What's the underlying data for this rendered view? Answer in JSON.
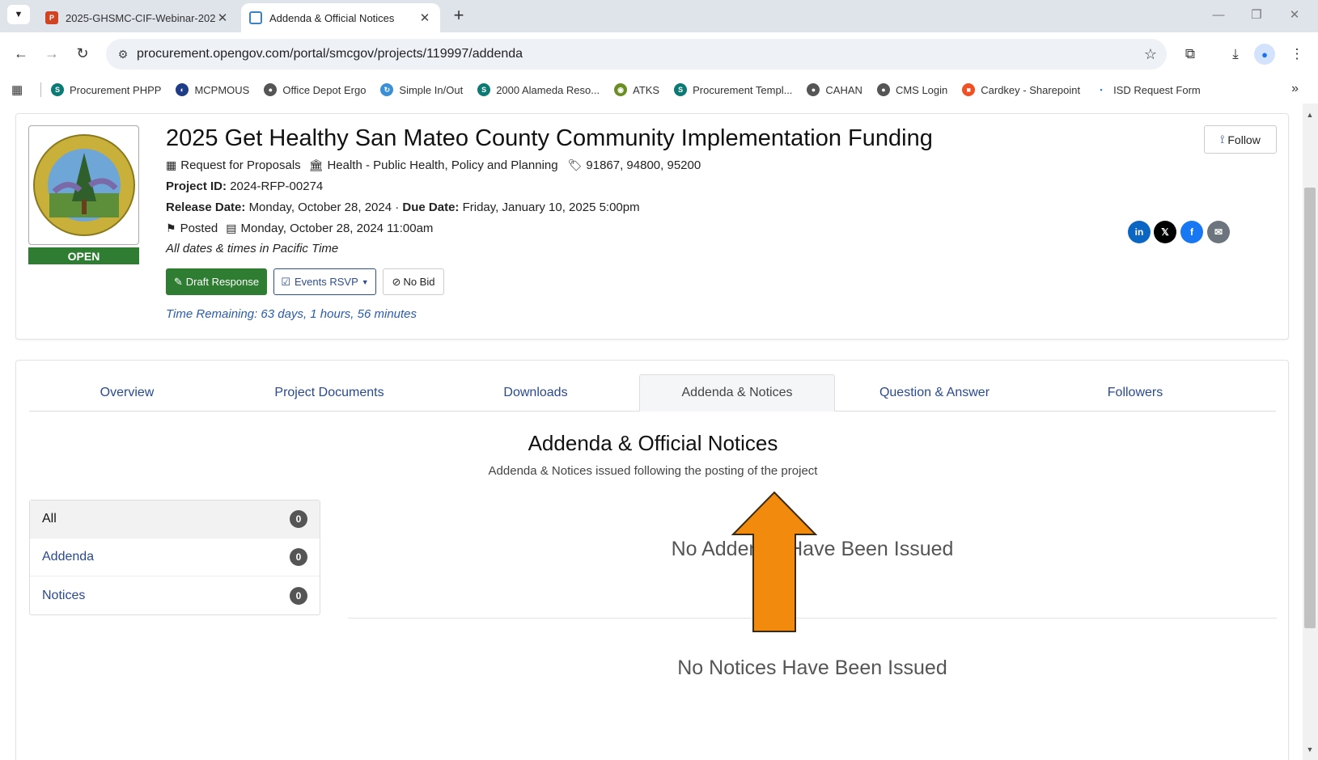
{
  "browser": {
    "tabs": [
      {
        "label": "2025-GHSMC-CIF-Webinar-202",
        "icon": "powerpoint-icon",
        "active": false
      },
      {
        "label": "Addenda & Official Notices",
        "icon": "opengov-icon",
        "active": true
      }
    ],
    "url": "procurement.opengov.com/portal/smcgov/projects/119997/addenda",
    "bookmarks": [
      {
        "label": "Procurement PHPP",
        "icon": "sharepoint-icon",
        "color": "#0b7a75"
      },
      {
        "label": "MCPMOUS",
        "icon": "chart-globe-icon",
        "color": "#1f3c88"
      },
      {
        "label": "Office Depot Ergo",
        "icon": "globe-icon",
        "color": "#555555"
      },
      {
        "label": "Simple In/Out",
        "icon": "refresh-icon",
        "color": "#3a8fd6"
      },
      {
        "label": "2000 Alameda Reso...",
        "icon": "sharepoint-icon",
        "color": "#0b7a75"
      },
      {
        "label": "ATKS",
        "icon": "seal-icon",
        "color": "#6b8e23"
      },
      {
        "label": "Procurement Templ...",
        "icon": "sharepoint-icon",
        "color": "#0b7a75"
      },
      {
        "label": "CAHAN",
        "icon": "globe-icon",
        "color": "#555555"
      },
      {
        "label": "CMS Login",
        "icon": "globe-icon",
        "color": "#555555"
      },
      {
        "label": "Cardkey - Sharepoint",
        "icon": "microsoft-icon",
        "color": "#f25022"
      },
      {
        "label": "ISD Request Form",
        "icon": "dot-icon",
        "color": "#2a7de1"
      }
    ]
  },
  "project": {
    "title": "2025 Get Healthy San Mateo County Community Implementation Funding",
    "type": "Request for Proposals",
    "department": "Health - Public Health, Policy and Planning",
    "codes": "91867, 94800, 95200",
    "project_id_label": "Project ID:",
    "project_id": "2024-RFP-00274",
    "release_label": "Release Date:",
    "release_date": "Monday, October 28, 2024",
    "separator": "·",
    "due_label": "Due Date:",
    "due_date": "Friday, January 10, 2025 5:00pm",
    "status_posted": "Posted",
    "posted_date": "Monday, October 28, 2024 11:00am",
    "timezone_note": "All dates & times in Pacific Time",
    "status_badge": "OPEN",
    "draft_button": "Draft Response",
    "rsvp_button": "Events RSVP",
    "nobid_button": "No Bid",
    "time_remaining": "Time Remaining: 63 days, 1 hours, 56 minutes",
    "follow_button": "Follow",
    "social": [
      {
        "name": "linkedin-icon",
        "glyph": "in",
        "color": "#0a66c2"
      },
      {
        "name": "x-icon",
        "glyph": "𝕏",
        "color": "#000000"
      },
      {
        "name": "facebook-icon",
        "glyph": "f",
        "color": "#1877f2"
      },
      {
        "name": "email-icon",
        "glyph": "✉",
        "color": "#6c757d"
      }
    ]
  },
  "page_tabs": [
    {
      "label": "Overview",
      "active": false
    },
    {
      "label": "Project Documents",
      "active": false
    },
    {
      "label": "Downloads",
      "active": false
    },
    {
      "label": "Addenda & Notices",
      "active": true
    },
    {
      "label": "Question & Answer",
      "active": false
    },
    {
      "label": "Followers",
      "active": false
    }
  ],
  "addenda": {
    "title": "Addenda & Official Notices",
    "subtitle": "Addenda & Notices issued following the posting of the project",
    "filters": [
      {
        "label": "All",
        "count": "0",
        "active": true
      },
      {
        "label": "Addenda",
        "count": "0",
        "active": false
      },
      {
        "label": "Notices",
        "count": "0",
        "active": false
      }
    ],
    "no_addenda": "No Addenda Have Been Issued",
    "no_notices": "No Notices Have Been Issued"
  },
  "colors": {
    "accent_green": "#2e7d32",
    "link_blue": "#2a4a8f",
    "overlay_arrow": "#f28a0e"
  }
}
